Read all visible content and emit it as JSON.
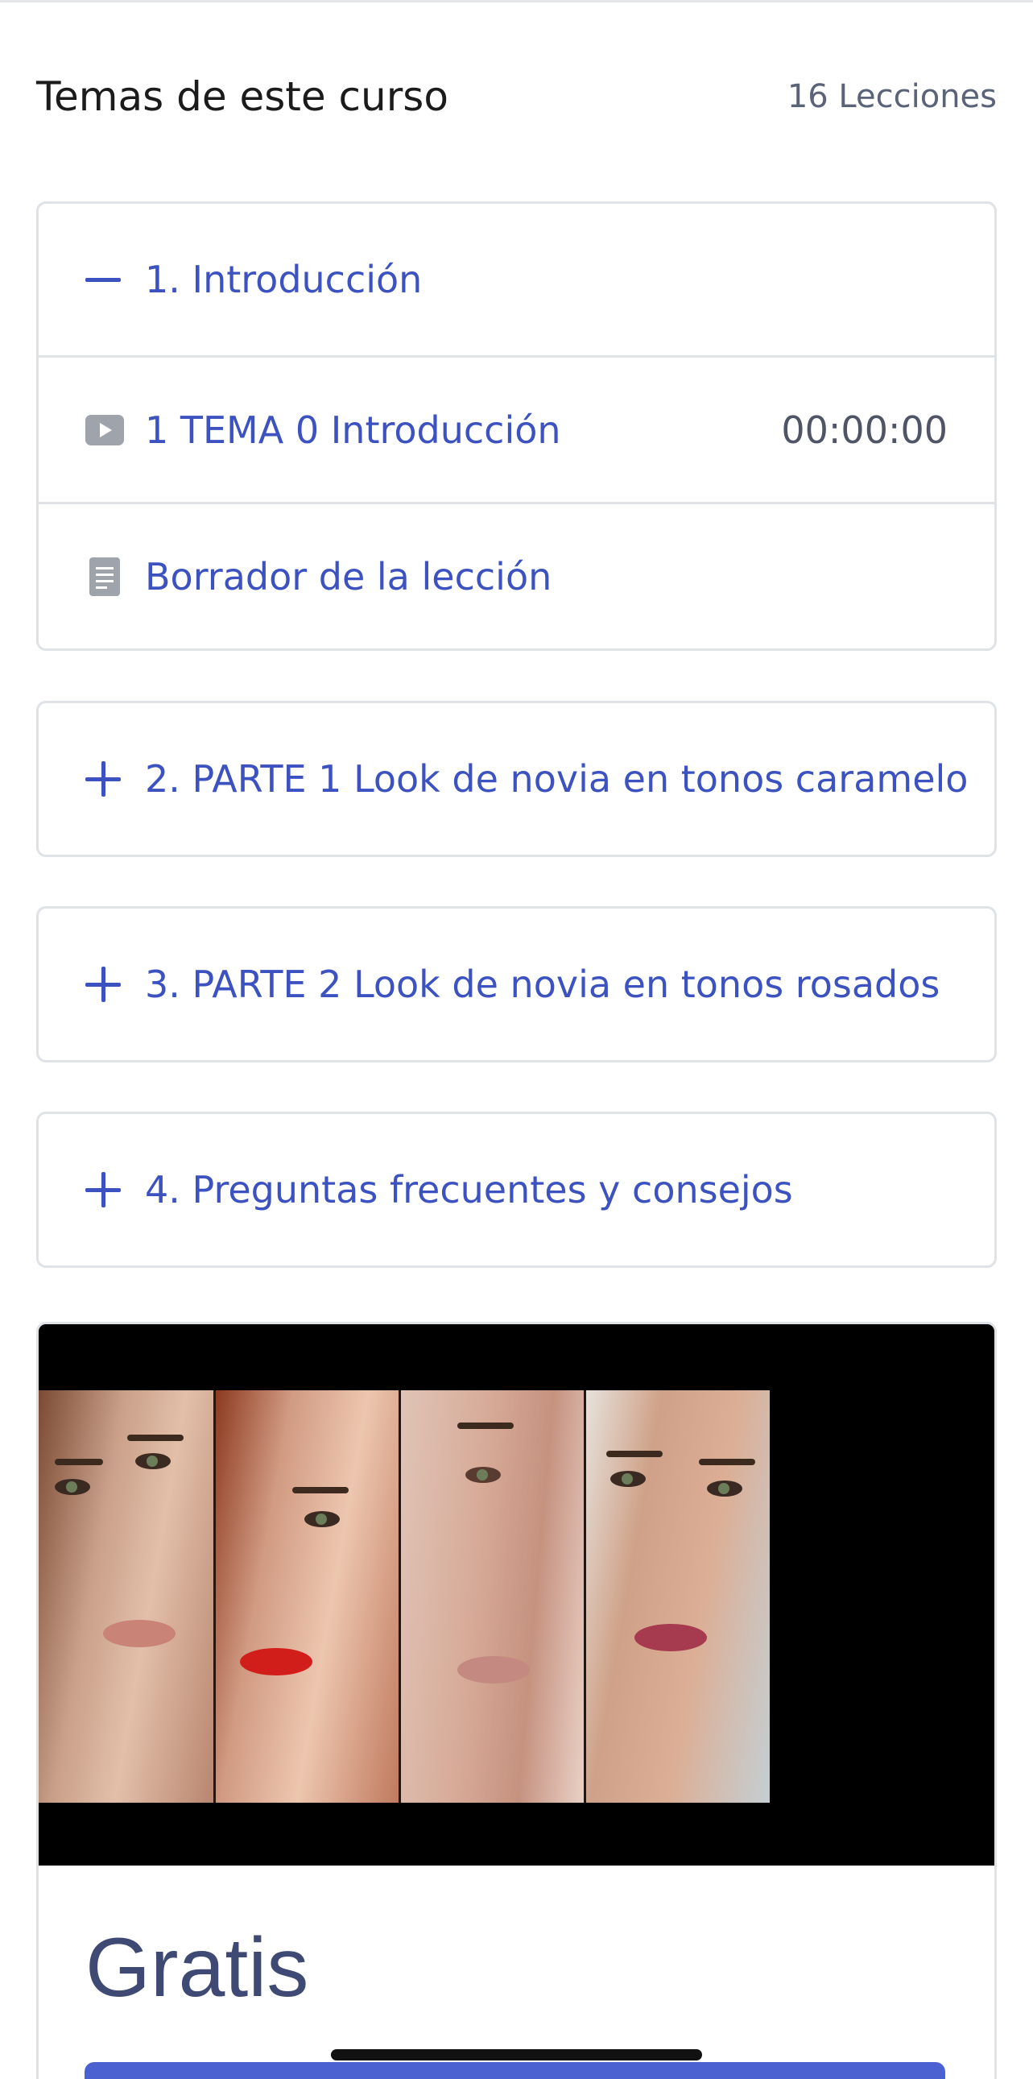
{
  "header": {
    "title": "Temas de este curso",
    "lesson_count": "16 Lecciones"
  },
  "sections": [
    {
      "title": "1. Introducción",
      "state": "expanded",
      "lessons": [
        {
          "type": "video",
          "icon": "play-icon",
          "title": "1 TEMA 0 Introducción",
          "duration": "00:00:00"
        },
        {
          "type": "document",
          "icon": "document-icon",
          "title": "Borrador de la lección"
        }
      ]
    },
    {
      "title": "2. PARTE 1 Look de novia en tonos caramelo",
      "state": "collapsed"
    },
    {
      "title": "3. PARTE 2 Look de novia en tonos rosados",
      "state": "collapsed"
    },
    {
      "title": "4. Preguntas frecuentes y consejos",
      "state": "collapsed"
    }
  ],
  "promo": {
    "price": "Gratis"
  },
  "colors": {
    "accent": "#3b52c0",
    "button": "#4b61d1",
    "muted_text": "#5b6378",
    "border": "#dfe2e6"
  }
}
